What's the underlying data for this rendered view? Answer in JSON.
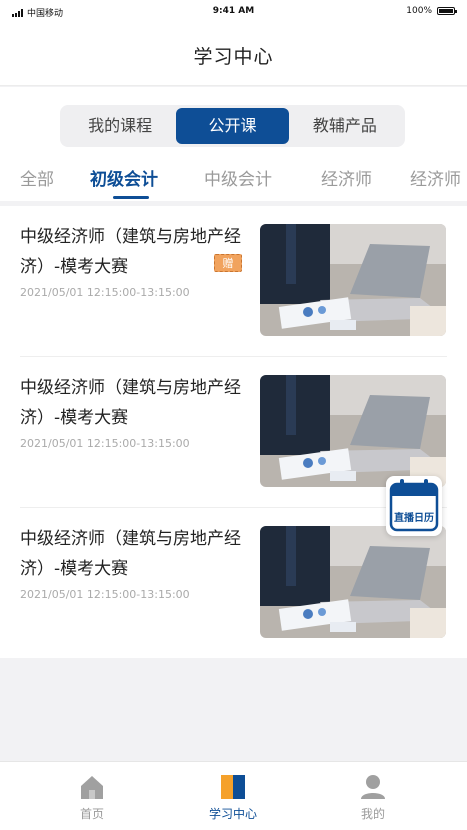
{
  "status_bar": {
    "carrier": "中国移动",
    "time": "9:41 AM",
    "battery": "100%"
  },
  "header": {
    "title": "学习中心"
  },
  "segmented": {
    "items": [
      "我的课程",
      "公开课",
      "教辅产品"
    ],
    "active_index": 1
  },
  "categories": {
    "items": [
      "全部",
      "初级会计",
      "中级会计",
      "经济师",
      "经济师"
    ],
    "active_index": 1
  },
  "courses": [
    {
      "title": "中级经济师（建筑与房地产经济）-模考大赛",
      "date": "2021/05/01 12:15:00-13:15:00",
      "badge": "赠"
    },
    {
      "title": "中级经济师（建筑与房地产经济）-模考大赛",
      "date": "2021/05/01 12:15:00-13:15:00"
    },
    {
      "title": "中级经济师（建筑与房地产经济）-模考大赛",
      "date": "2021/05/01 12:15:00-13:15:00"
    }
  ],
  "floating": {
    "label": "直播日历",
    "icon": "calendar-icon"
  },
  "tabbar": {
    "items": [
      {
        "label": "首页",
        "icon": "home-icon"
      },
      {
        "label": "学习中心",
        "icon": "book-icon"
      },
      {
        "label": "我的",
        "icon": "user-icon"
      }
    ],
    "active_index": 1
  },
  "colors": {
    "accent": "#0e4e96",
    "badge": "#f1a35e",
    "inactive": "#9a9a9a"
  }
}
